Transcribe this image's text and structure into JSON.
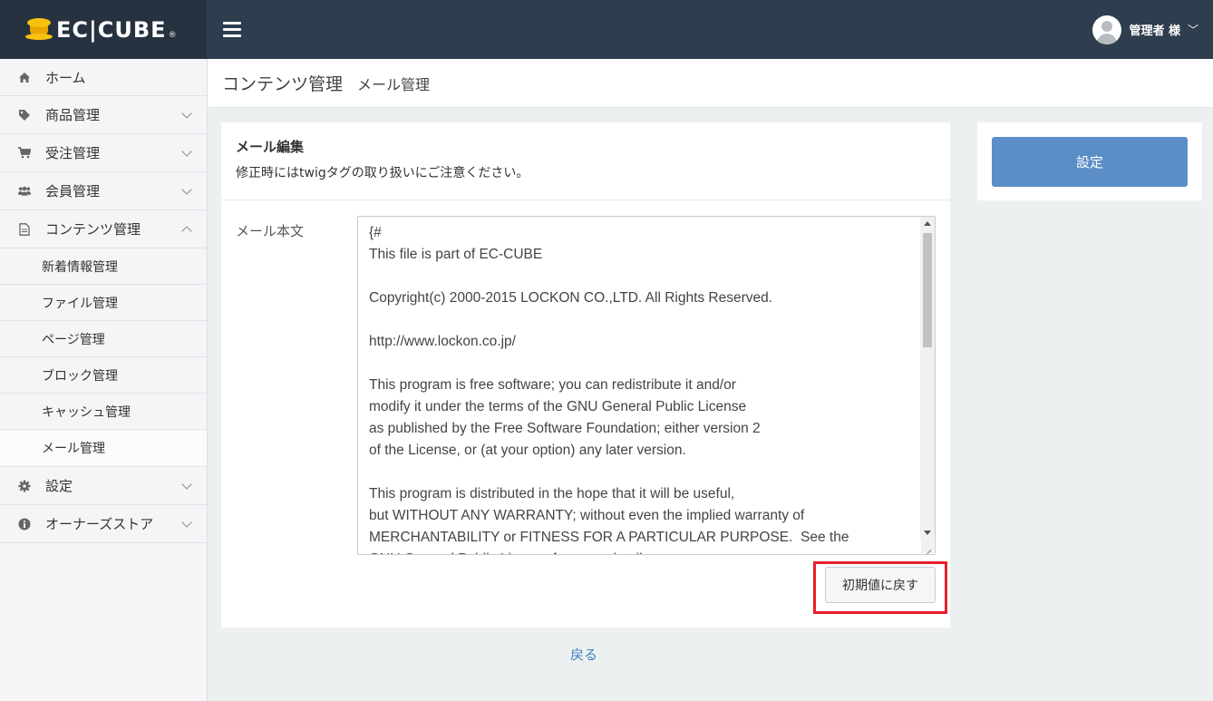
{
  "header": {
    "logo_text": "EC|CUBE",
    "logo_reg": "®",
    "user_name": "管理者 様"
  },
  "sidebar": {
    "items": [
      {
        "label": "ホーム",
        "icon": "home-icon"
      },
      {
        "label": "商品管理",
        "icon": "tag-icon"
      },
      {
        "label": "受注管理",
        "icon": "cart-icon"
      },
      {
        "label": "会員管理",
        "icon": "users-icon"
      },
      {
        "label": "コンテンツ管理",
        "icon": "file-icon"
      },
      {
        "label": "設定",
        "icon": "gear-icon"
      },
      {
        "label": "オーナーズストア",
        "icon": "info-icon"
      }
    ],
    "sub_items": [
      "新着情報管理",
      "ファイル管理",
      "ページ管理",
      "ブロック管理",
      "キャッシュ管理",
      "メール管理"
    ]
  },
  "page": {
    "title": "コンテンツ管理",
    "subtitle": "メール管理"
  },
  "card": {
    "title": "メール編集",
    "description": "修正時にはtwigタグの取り扱いにご注意ください。",
    "field_label": "メール本文",
    "body_text": "{#\nThis file is part of EC-CUBE\n\nCopyright(c) 2000-2015 LOCKON CO.,LTD. All Rights Reserved.\n\nhttp://www.lockon.co.jp/\n\nThis program is free software; you can redistribute it and/or\nmodify it under the terms of the GNU General Public License\nas published by the Free Software Foundation; either version 2\nof the License, or (at your option) any later version.\n\nThis program is distributed in the hope that it will be useful,\nbut WITHOUT ANY WARRANTY; without even the implied warranty of\nMERCHANTABILITY or FITNESS FOR A PARTICULAR PURPOSE.  See the\nGNU General Public License for more details.",
    "reset_label": "初期値に戻す"
  },
  "actions": {
    "save_label": "設定",
    "back_label": "戻る"
  },
  "colors": {
    "topbar": "#2f3e4e",
    "accent": "#5b8ec7",
    "highlight": "#e8202a",
    "link": "#437ec4"
  }
}
